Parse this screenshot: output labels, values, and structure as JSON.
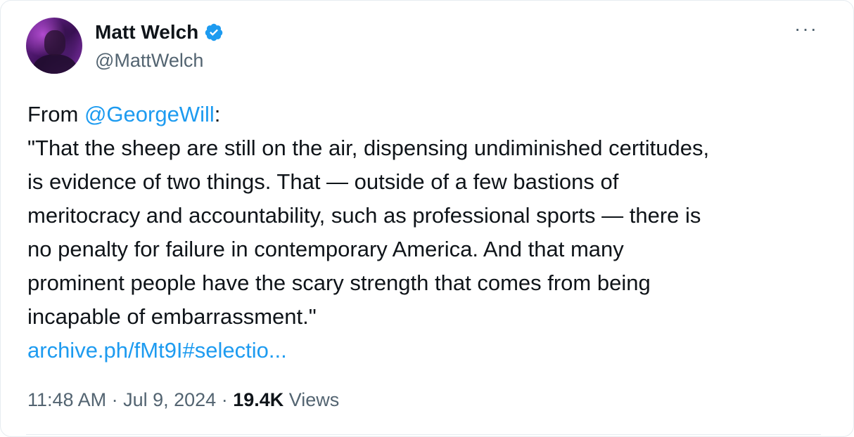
{
  "author": {
    "display_name": "Matt Welch",
    "handle": "@MattWelch",
    "verified_icon": "verified-badge-icon",
    "avatar_icon": "avatar-photo"
  },
  "menu": {
    "more_label": "···"
  },
  "tweet": {
    "from_prefix": "From ",
    "mention": "@GeorgeWill",
    "after_mention": ":",
    "quote_lines": [
      "\"That the sheep are still on the air, dispensing undiminished certitudes,",
      "is evidence of two things. That — outside of a few bastions of",
      "meritocracy and accountability, such as professional sports — there is",
      "no penalty for failure in contemporary America. And that many",
      "prominent people have the scary strength that comes from being",
      "incapable of embarrassment.\""
    ],
    "link": "archive.ph/fMt9I#selectio..."
  },
  "meta": {
    "time": "11:48 AM",
    "sep1": " · ",
    "date": "Jul 9, 2024",
    "sep2": " · ",
    "views_count": "19.4K",
    "views_label": " Views"
  },
  "colors": {
    "link": "#1d9bf0",
    "secondary": "#536471",
    "text": "#0f1419"
  }
}
